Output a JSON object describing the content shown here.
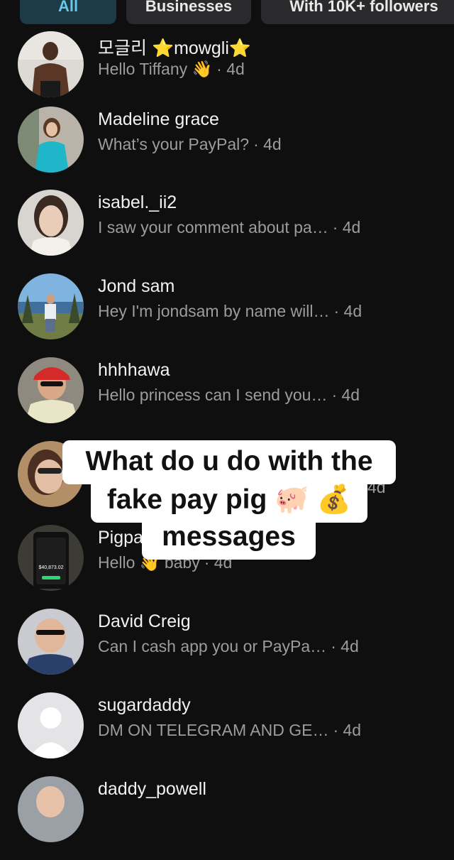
{
  "filters": {
    "all": "All",
    "businesses": "Businesses",
    "followers": "With 10K+ followers"
  },
  "conversations": [
    {
      "name": "모글리 ⭐mowgli⭐",
      "message": "Hello Tiffany 👋",
      "time": "· 4d"
    },
    {
      "name": "Madeline grace",
      "message": "What’s your PayPal?",
      "time": "· 4d"
    },
    {
      "name": "isabel._ii2",
      "message": "I saw your comment about pa…",
      "time": "· 4d"
    },
    {
      "name": "Jond sam",
      "message": "Hey I'm jondsam by name will…",
      "time": "· 4d"
    },
    {
      "name": "hhhhawa",
      "message": "Hello princess can I send you…",
      "time": "· 4d"
    },
    {
      "name": "",
      "message": "",
      "time": "4d"
    },
    {
      "name": "Pigpa",
      "message": "Hello 👋 baby",
      "time": "· 4d"
    },
    {
      "name": "David Creig",
      "message": "Can I cash app you or PayPa…",
      "time": "· 4d"
    },
    {
      "name": "sugardaddy",
      "message": "DM ON TELEGRAM AND GE…",
      "time": "· 4d"
    },
    {
      "name": "daddy_powell",
      "message": "",
      "time": ""
    }
  ],
  "caption": {
    "line1": "What do u do with the",
    "line2": "fake pay pig 🐖 💰",
    "line3": "messages"
  },
  "avatar_amount": "$40,873.02",
  "colors": {
    "background": "#0f0f10",
    "chip": "#2a2a2c",
    "chip_active": "#1c3a47",
    "chip_active_text": "#67c9e8",
    "secondary_text": "#9c9c9e",
    "caption_bg": "#ffffff"
  }
}
